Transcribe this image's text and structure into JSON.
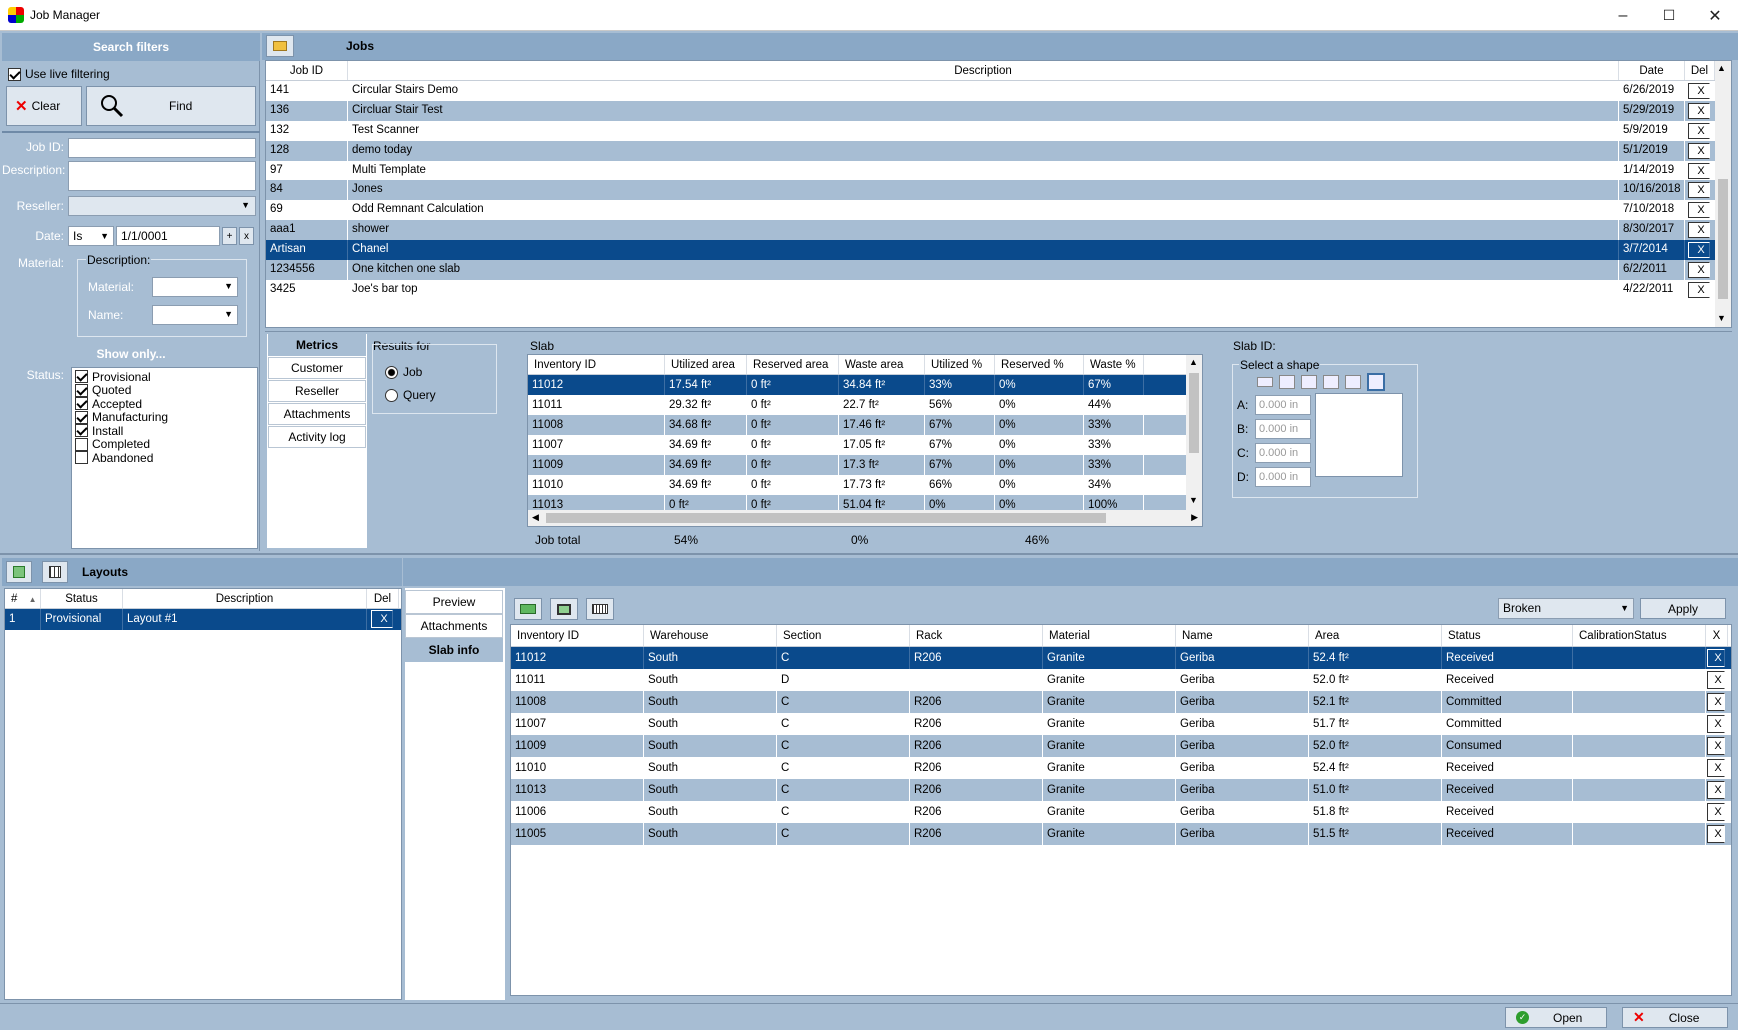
{
  "window": {
    "title": "Job Manager",
    "minimize": "–",
    "maximize": "☐",
    "close": "✕"
  },
  "filters": {
    "header": "Search filters",
    "live_filtering": "Use live filtering",
    "clear": "Clear",
    "find": "Find",
    "job_id_label": "Job ID:",
    "description_label": "Description:",
    "reseller_label": "Reseller:",
    "date_label": "Date:",
    "date_op": "Is",
    "date_value": "1/1/0001",
    "date_plus": "+",
    "date_x": "x",
    "material_label": "Material:",
    "material_group": "Description:",
    "material_sub": "Material:",
    "name_sub": "Name:",
    "show_only": "Show only...",
    "status_label": "Status:",
    "statuses": [
      {
        "label": "Provisional",
        "checked": true
      },
      {
        "label": "Quoted",
        "checked": true
      },
      {
        "label": "Accepted",
        "checked": true
      },
      {
        "label": "Manufacturing",
        "checked": true
      },
      {
        "label": "Install",
        "checked": true
      },
      {
        "label": "Completed",
        "checked": false
      },
      {
        "label": "Abandoned",
        "checked": false
      }
    ]
  },
  "jobs": {
    "header": "Jobs",
    "columns": [
      "Job ID",
      "Description",
      "Date",
      "Del"
    ],
    "rows": [
      {
        "id": "141",
        "desc": "Circular Stairs Demo",
        "date": "6/26/2019"
      },
      {
        "id": "136",
        "desc": "Circluar Stair Test",
        "date": "5/29/2019"
      },
      {
        "id": "132",
        "desc": "Test Scanner",
        "date": "5/9/2019"
      },
      {
        "id": "128",
        "desc": "demo today",
        "date": "5/1/2019"
      },
      {
        "id": "97",
        "desc": "Multi Template",
        "date": "1/14/2019"
      },
      {
        "id": "84",
        "desc": "Jones",
        "date": "10/16/2018"
      },
      {
        "id": "69",
        "desc": "Odd Remnant Calculation",
        "date": "7/10/2018"
      },
      {
        "id": "aaa1",
        "desc": "shower",
        "date": "8/30/2017"
      },
      {
        "id": "Artisan",
        "desc": "Chanel",
        "date": "3/7/2014"
      },
      {
        "id": "1234556",
        "desc": "One kitchen one slab",
        "date": "6/2/2011"
      },
      {
        "id": "3425",
        "desc": "Joe's bar top",
        "date": "4/22/2011"
      }
    ],
    "selected_index": 8,
    "del": "X"
  },
  "metrics_tabs": [
    "Metrics",
    "Customer",
    "Reseller",
    "Attachments",
    "Activity log"
  ],
  "results_for": {
    "label": "Results for",
    "job": "Job",
    "query": "Query"
  },
  "slab": {
    "label": "Slab",
    "columns": [
      "Inventory ID",
      "Utilized area",
      "Reserved area",
      "Waste area",
      "Utilized %",
      "Reserved %",
      "Waste %"
    ],
    "rows": [
      [
        "11012",
        "17.54 ft²",
        "0 ft²",
        "34.84 ft²",
        "33%",
        "0%",
        "67%"
      ],
      [
        "11011",
        "29.32 ft²",
        "0 ft²",
        "22.7 ft²",
        "56%",
        "0%",
        "44%"
      ],
      [
        "11008",
        "34.68 ft²",
        "0 ft²",
        "17.46 ft²",
        "67%",
        "0%",
        "33%"
      ],
      [
        "11007",
        "34.69 ft²",
        "0 ft²",
        "17.05 ft²",
        "67%",
        "0%",
        "33%"
      ],
      [
        "11009",
        "34.69 ft²",
        "0 ft²",
        "17.3 ft²",
        "67%",
        "0%",
        "33%"
      ],
      [
        "11010",
        "34.69 ft²",
        "0 ft²",
        "17.73 ft²",
        "66%",
        "0%",
        "34%"
      ],
      [
        "11013",
        "0 ft²",
        "0 ft²",
        "51.04 ft²",
        "0%",
        "0%",
        "100%"
      ]
    ],
    "job_total_label": "Job total",
    "job_total": [
      "54%",
      "0%",
      "46%"
    ]
  },
  "slab_id": {
    "label": "Slab ID:",
    "select_shape": "Select a shape",
    "dims": [
      {
        "label": "A:",
        "value": "0.000 in"
      },
      {
        "label": "B:",
        "value": "0.000 in"
      },
      {
        "label": "C:",
        "value": "0.000 in"
      },
      {
        "label": "D:",
        "value": "0.000 in"
      }
    ]
  },
  "layouts": {
    "header": "Layouts",
    "columns": [
      "#",
      "Status",
      "Description",
      "Del"
    ],
    "rows": [
      {
        "num": "1",
        "status": "Provisional",
        "desc": "Layout #1"
      }
    ],
    "del": "X"
  },
  "layout_tabs": [
    "Preview",
    "Attachments",
    "Slab info"
  ],
  "slabinfo": {
    "dropdown": "Broken",
    "apply": "Apply",
    "columns": [
      "Inventory ID",
      "Warehouse",
      "Section",
      "Rack",
      "Material",
      "Name",
      "Area",
      "Status",
      "CalibrationStatus",
      "X"
    ],
    "rows": [
      [
        "11012",
        "South",
        "C",
        "R206",
        "Granite",
        "Geriba",
        "52.4 ft²",
        "Received",
        ""
      ],
      [
        "11011",
        "South",
        "D",
        "",
        "Granite",
        "Geriba",
        "52.0 ft²",
        "Received",
        ""
      ],
      [
        "11008",
        "South",
        "C",
        "R206",
        "Granite",
        "Geriba",
        "52.1 ft²",
        "Committed",
        ""
      ],
      [
        "11007",
        "South",
        "C",
        "R206",
        "Granite",
        "Geriba",
        "51.7 ft²",
        "Committed",
        ""
      ],
      [
        "11009",
        "South",
        "C",
        "R206",
        "Granite",
        "Geriba",
        "52.0 ft²",
        "Consumed",
        ""
      ],
      [
        "11010",
        "South",
        "C",
        "R206",
        "Granite",
        "Geriba",
        "52.4 ft²",
        "Received",
        ""
      ],
      [
        "11013",
        "South",
        "C",
        "R206",
        "Granite",
        "Geriba",
        "51.0 ft²",
        "Received",
        ""
      ],
      [
        "11006",
        "South",
        "C",
        "R206",
        "Granite",
        "Geriba",
        "51.8 ft²",
        "Received",
        ""
      ],
      [
        "11005",
        "South",
        "C",
        "R206",
        "Granite",
        "Geriba",
        "51.5 ft²",
        "Received",
        ""
      ]
    ],
    "del": "X"
  },
  "footer": {
    "open": "Open",
    "close": "Close"
  },
  "colors": {
    "selected": "#0a4a8c",
    "alt_row": "#a7bdd3",
    "header": "#8aa8c6"
  }
}
